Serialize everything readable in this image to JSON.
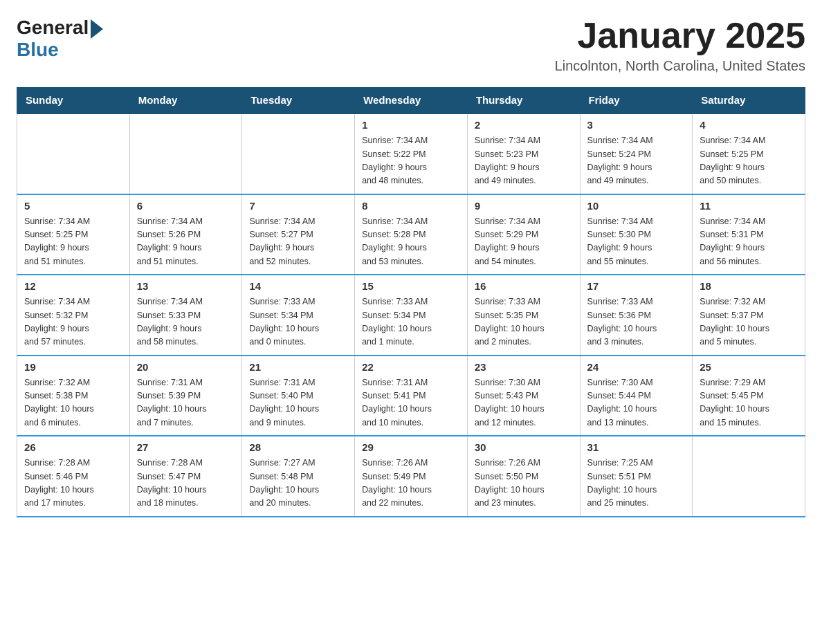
{
  "header": {
    "title": "January 2025",
    "location": "Lincolnton, North Carolina, United States",
    "logo_general": "General",
    "logo_blue": "Blue"
  },
  "calendar": {
    "days_of_week": [
      "Sunday",
      "Monday",
      "Tuesday",
      "Wednesday",
      "Thursday",
      "Friday",
      "Saturday"
    ],
    "weeks": [
      [
        {
          "day": "",
          "info": ""
        },
        {
          "day": "",
          "info": ""
        },
        {
          "day": "",
          "info": ""
        },
        {
          "day": "1",
          "info": "Sunrise: 7:34 AM\nSunset: 5:22 PM\nDaylight: 9 hours\nand 48 minutes."
        },
        {
          "day": "2",
          "info": "Sunrise: 7:34 AM\nSunset: 5:23 PM\nDaylight: 9 hours\nand 49 minutes."
        },
        {
          "day": "3",
          "info": "Sunrise: 7:34 AM\nSunset: 5:24 PM\nDaylight: 9 hours\nand 49 minutes."
        },
        {
          "day": "4",
          "info": "Sunrise: 7:34 AM\nSunset: 5:25 PM\nDaylight: 9 hours\nand 50 minutes."
        }
      ],
      [
        {
          "day": "5",
          "info": "Sunrise: 7:34 AM\nSunset: 5:25 PM\nDaylight: 9 hours\nand 51 minutes."
        },
        {
          "day": "6",
          "info": "Sunrise: 7:34 AM\nSunset: 5:26 PM\nDaylight: 9 hours\nand 51 minutes."
        },
        {
          "day": "7",
          "info": "Sunrise: 7:34 AM\nSunset: 5:27 PM\nDaylight: 9 hours\nand 52 minutes."
        },
        {
          "day": "8",
          "info": "Sunrise: 7:34 AM\nSunset: 5:28 PM\nDaylight: 9 hours\nand 53 minutes."
        },
        {
          "day": "9",
          "info": "Sunrise: 7:34 AM\nSunset: 5:29 PM\nDaylight: 9 hours\nand 54 minutes."
        },
        {
          "day": "10",
          "info": "Sunrise: 7:34 AM\nSunset: 5:30 PM\nDaylight: 9 hours\nand 55 minutes."
        },
        {
          "day": "11",
          "info": "Sunrise: 7:34 AM\nSunset: 5:31 PM\nDaylight: 9 hours\nand 56 minutes."
        }
      ],
      [
        {
          "day": "12",
          "info": "Sunrise: 7:34 AM\nSunset: 5:32 PM\nDaylight: 9 hours\nand 57 minutes."
        },
        {
          "day": "13",
          "info": "Sunrise: 7:34 AM\nSunset: 5:33 PM\nDaylight: 9 hours\nand 58 minutes."
        },
        {
          "day": "14",
          "info": "Sunrise: 7:33 AM\nSunset: 5:34 PM\nDaylight: 10 hours\nand 0 minutes."
        },
        {
          "day": "15",
          "info": "Sunrise: 7:33 AM\nSunset: 5:34 PM\nDaylight: 10 hours\nand 1 minute."
        },
        {
          "day": "16",
          "info": "Sunrise: 7:33 AM\nSunset: 5:35 PM\nDaylight: 10 hours\nand 2 minutes."
        },
        {
          "day": "17",
          "info": "Sunrise: 7:33 AM\nSunset: 5:36 PM\nDaylight: 10 hours\nand 3 minutes."
        },
        {
          "day": "18",
          "info": "Sunrise: 7:32 AM\nSunset: 5:37 PM\nDaylight: 10 hours\nand 5 minutes."
        }
      ],
      [
        {
          "day": "19",
          "info": "Sunrise: 7:32 AM\nSunset: 5:38 PM\nDaylight: 10 hours\nand 6 minutes."
        },
        {
          "day": "20",
          "info": "Sunrise: 7:31 AM\nSunset: 5:39 PM\nDaylight: 10 hours\nand 7 minutes."
        },
        {
          "day": "21",
          "info": "Sunrise: 7:31 AM\nSunset: 5:40 PM\nDaylight: 10 hours\nand 9 minutes."
        },
        {
          "day": "22",
          "info": "Sunrise: 7:31 AM\nSunset: 5:41 PM\nDaylight: 10 hours\nand 10 minutes."
        },
        {
          "day": "23",
          "info": "Sunrise: 7:30 AM\nSunset: 5:43 PM\nDaylight: 10 hours\nand 12 minutes."
        },
        {
          "day": "24",
          "info": "Sunrise: 7:30 AM\nSunset: 5:44 PM\nDaylight: 10 hours\nand 13 minutes."
        },
        {
          "day": "25",
          "info": "Sunrise: 7:29 AM\nSunset: 5:45 PM\nDaylight: 10 hours\nand 15 minutes."
        }
      ],
      [
        {
          "day": "26",
          "info": "Sunrise: 7:28 AM\nSunset: 5:46 PM\nDaylight: 10 hours\nand 17 minutes."
        },
        {
          "day": "27",
          "info": "Sunrise: 7:28 AM\nSunset: 5:47 PM\nDaylight: 10 hours\nand 18 minutes."
        },
        {
          "day": "28",
          "info": "Sunrise: 7:27 AM\nSunset: 5:48 PM\nDaylight: 10 hours\nand 20 minutes."
        },
        {
          "day": "29",
          "info": "Sunrise: 7:26 AM\nSunset: 5:49 PM\nDaylight: 10 hours\nand 22 minutes."
        },
        {
          "day": "30",
          "info": "Sunrise: 7:26 AM\nSunset: 5:50 PM\nDaylight: 10 hours\nand 23 minutes."
        },
        {
          "day": "31",
          "info": "Sunrise: 7:25 AM\nSunset: 5:51 PM\nDaylight: 10 hours\nand 25 minutes."
        },
        {
          "day": "",
          "info": ""
        }
      ]
    ]
  }
}
